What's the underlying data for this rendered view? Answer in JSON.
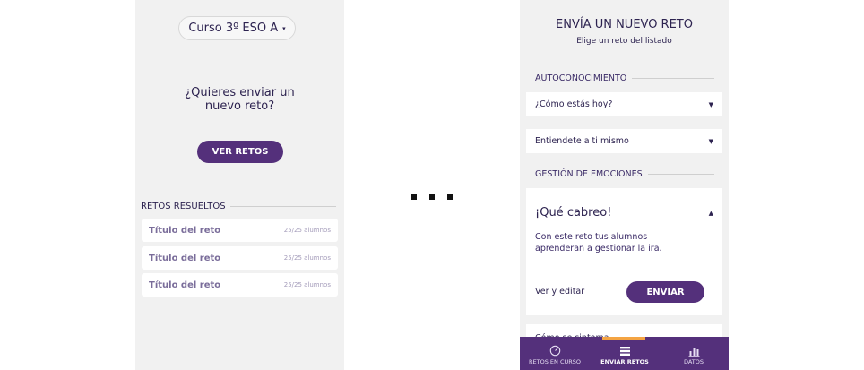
{
  "left_screen": {
    "course_selector": {
      "label": "Curso 3º ESO A",
      "caret": "▾"
    },
    "question_line1": "¿Quieres enviar un",
    "question_line2": "nuevo reto?",
    "ver_retos_label": "VER RETOS",
    "solved_header": "RETOS RESUELTOS",
    "solved_items": [
      {
        "title": "Título del reto",
        "count": "25/25 alumnos"
      },
      {
        "title": "Título del reto",
        "count": "25/25 alumnos"
      },
      {
        "title": "Título del reto",
        "count": "25/25 alumnos"
      }
    ]
  },
  "right_screen": {
    "title": "ENVÍA UN NUEVO RETO",
    "subtitle": "Elige un reto del listado",
    "section1": "AUTOCONOCIMIENTO",
    "dropdown1": "¿Cómo estás hoy?",
    "dropdown2": "Entiendete a ti mismo",
    "section2": "GESTIÓN DE EMOCIONES",
    "card": {
      "title": "¡Qué cabreo!",
      "description": "Con este reto tus alumnos aprenderan a gestionar la ira.",
      "edit_label": "Ver y editar",
      "send_label": "ENVIAR"
    },
    "peek_text": "Cómo se sintoma...",
    "caret_down": "▼",
    "caret_up": "▲",
    "tabs": [
      {
        "label": "RETOS EN CURSO",
        "icon": "gauge-icon",
        "active": false
      },
      {
        "label": "ENVIAR RETOS",
        "icon": "stack-icon",
        "active": true
      },
      {
        "label": "DATOS",
        "icon": "bar-chart-icon",
        "active": false
      }
    ]
  },
  "colors": {
    "brand_purple": "#54307b",
    "screen_bg": "#f1f1f1",
    "accent_orange": "#f4a443"
  }
}
